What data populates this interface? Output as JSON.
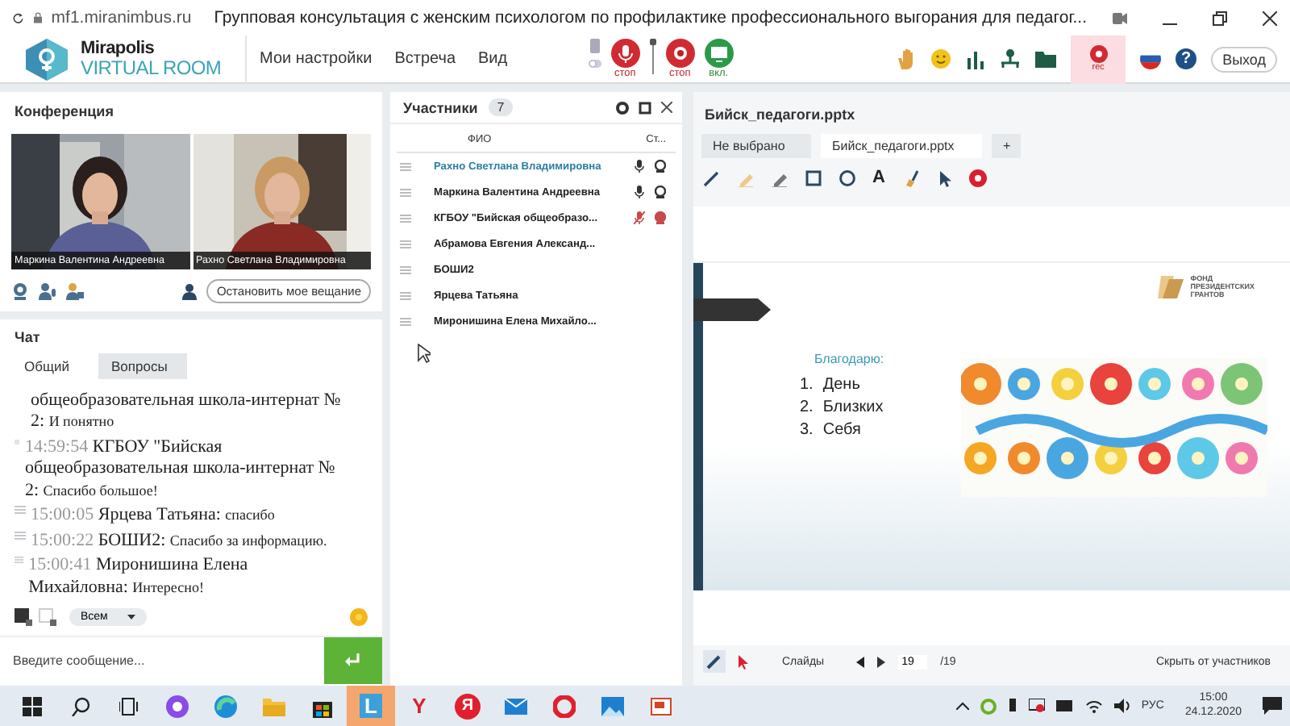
{
  "browser": {
    "url": "mf1.miranimbus.ru",
    "title": "Групповая консультация с женским психологом по профилактике профессионального выгорания для педагог..."
  },
  "app": {
    "logo_top": "Mirapolis",
    "logo_bottom": "VIRTUAL ROOM",
    "menu": [
      "Мои настройки",
      "Встреча",
      "Вид"
    ],
    "media": [
      {
        "kind": "mic",
        "on": true,
        "label": "стоп"
      },
      {
        "kind": "camera",
        "on": true,
        "label": "стоп"
      },
      {
        "kind": "screen",
        "on": false,
        "label": "вкл."
      }
    ],
    "rec_label": "rec",
    "help": "?",
    "exit": "Выход"
  },
  "conference": {
    "title": "Конференция",
    "videos": [
      {
        "name": "Маркина Валентина  Андреевна",
        "kind": "dark"
      },
      {
        "name": "Рахно Светлана  Владимировна",
        "kind": "blonde"
      }
    ],
    "stop_button": "Остановить мое вещание"
  },
  "chat": {
    "title": "Чат",
    "tabs": [
      {
        "label": "Общий",
        "selected": true
      },
      {
        "label": "Вопросы",
        "selected": false
      }
    ],
    "messages": [
      {
        "author": "общеобразовательная школа-интернат № 2:",
        "text": "И понятно"
      },
      {
        "time": "14:59:54",
        "author": "КГБОУ \"Бийская общеобразовательная школа-интернат № 2:",
        "text": "Спасибо большое!"
      },
      {
        "time": "15:00:05",
        "author": "Ярцева Татьяна:",
        "text": "спасибо"
      },
      {
        "time": "15:00:22",
        "author": "БОШИ2:",
        "text": "Спасибо за информацию."
      },
      {
        "time": "15:00:41",
        "author": "Миронишина  Елена Михайловна:",
        "text": "Интересно!"
      }
    ],
    "recipient": "Всем",
    "placeholder": "Введите сообщение..."
  },
  "participants": {
    "title": "Участники",
    "count": "7",
    "columns": [
      "ФИО",
      "Ст..."
    ],
    "rows": [
      {
        "name": "Рахно Светлана  Владимировна",
        "self": true,
        "media": true,
        "muted": false
      },
      {
        "name": "Маркина Валентина  Андреевна",
        "self": false,
        "media": true,
        "muted": false
      },
      {
        "name": "КГБОУ \"Бийская общеобразо...",
        "self": false,
        "media": true,
        "muted": true
      },
      {
        "name": "Абрамова  Евгения  Александ...",
        "self": false
      },
      {
        "name": "БОШИ2",
        "self": false
      },
      {
        "name": "Ярцева Татьяна",
        "self": false
      },
      {
        "name": "Миронишина  Елена Михайло...",
        "self": false
      }
    ]
  },
  "presentation": {
    "title": "Бийск_педагоги.pptx",
    "tabs": [
      {
        "label": "Не выбрано",
        "selected": false
      },
      {
        "label": "Бийск_педагоги.pptx",
        "selected": true
      },
      {
        "label": "+",
        "selected": false
      }
    ],
    "tools": [
      {
        "kind": "pen"
      },
      {
        "kind": "highlighter"
      },
      {
        "kind": "eraser"
      },
      {
        "kind": "rect"
      },
      {
        "kind": "circle"
      },
      {
        "kind": "text",
        "glyph": "A"
      },
      {
        "kind": "brush"
      },
      {
        "kind": "pointer"
      },
      {
        "kind": "stop"
      }
    ],
    "slide": {
      "logo": [
        "ФОНД",
        "ПРЕЗИДЕНТСКИХ",
        "ГРАНТОВ"
      ],
      "heading": "Благодарю:",
      "list": [
        {
          "number": "1.",
          "text": "День"
        },
        {
          "number": "2.",
          "text": "Близких"
        },
        {
          "number": "3.",
          "text": "Себя"
        }
      ]
    },
    "footer": {
      "slides": "Слайды",
      "page": "19",
      "total": "/19",
      "hide": "Скрыть от участников"
    }
  },
  "taskbar": {
    "apps": [
      {
        "kind": "alice",
        "selected": false
      },
      {
        "kind": "edge",
        "selected": false
      },
      {
        "kind": "folder",
        "selected": false
      },
      {
        "kind": "store",
        "selected": false
      },
      {
        "kind": "letter",
        "glyph": "L",
        "selected": true
      },
      {
        "kind": "letter",
        "glyph": "Y",
        "selected": false
      },
      {
        "kind": "round",
        "glyph": "Я",
        "selected": false
      },
      {
        "kind": "mail",
        "selected": false
      },
      {
        "kind": "opera",
        "selected": false
      },
      {
        "kind": "photos",
        "selected": false
      },
      {
        "kind": "slides",
        "selected": false
      }
    ],
    "lang": "РУС",
    "time": "15:00",
    "date": "24.12.2020"
  }
}
